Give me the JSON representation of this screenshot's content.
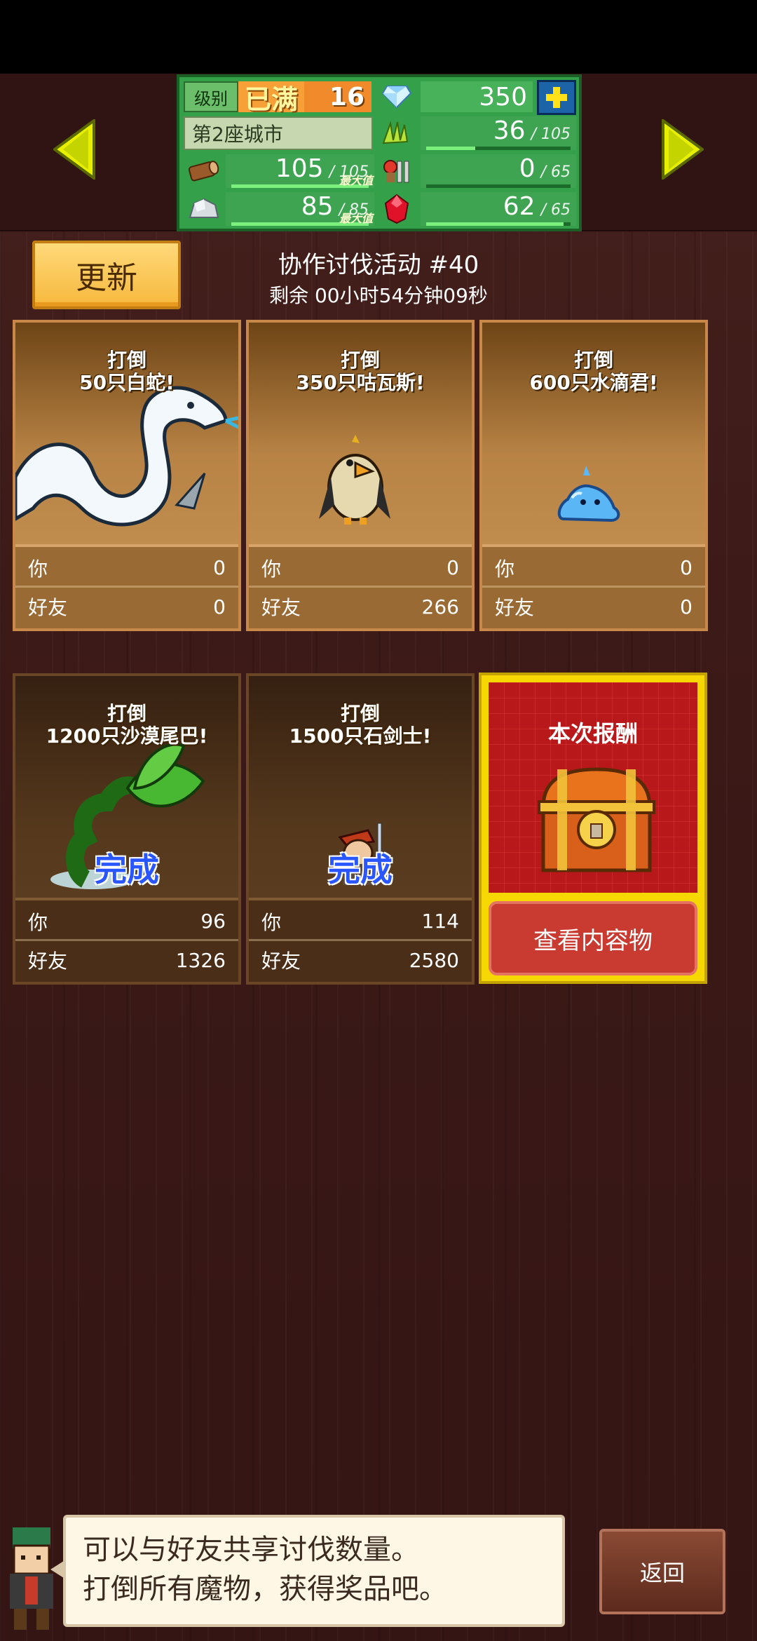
{
  "header": {
    "level_label": "级别",
    "level_max": "已满",
    "level_value": "16",
    "gems": "350",
    "city": "第2座城市",
    "max_tag": "最大值",
    "resources": [
      {
        "icon": "wood-icon",
        "value": "105",
        "max": "105",
        "fill": 1.0
      },
      {
        "icon": "stone-icon",
        "value": "85",
        "max": "85",
        "fill": 1.0
      },
      {
        "icon": "grass-icon",
        "value": "36",
        "max": "105",
        "fill": 0.34
      },
      {
        "icon": "food-icon",
        "value": "0",
        "max": "65",
        "fill": 0.0
      },
      {
        "icon": "ruby-icon",
        "value": "62",
        "max": "65",
        "fill": 0.95
      }
    ]
  },
  "event": {
    "update_label": "更新",
    "title": "协作讨伐活动 #40",
    "timer": "剩余 00小时54分钟09秒"
  },
  "cards": [
    {
      "goal_line1": "打倒",
      "goal_line2": "50只白蛇!",
      "you_label": "你",
      "you": "0",
      "friends_label": "好友",
      "friends": "0",
      "done": ""
    },
    {
      "goal_line1": "打倒",
      "goal_line2": "350只咕瓦斯!",
      "you_label": "你",
      "you": "0",
      "friends_label": "好友",
      "friends": "266",
      "done": ""
    },
    {
      "goal_line1": "打倒",
      "goal_line2": "600只水滴君!",
      "you_label": "你",
      "you": "0",
      "friends_label": "好友",
      "friends": "0",
      "done": ""
    },
    {
      "goal_line1": "打倒",
      "goal_line2": "1200只沙漠尾巴!",
      "you_label": "你",
      "you": "96",
      "friends_label": "好友",
      "friends": "1326",
      "done": "完成"
    },
    {
      "goal_line1": "打倒",
      "goal_line2": "1500只石剑士!",
      "you_label": "你",
      "you": "114",
      "friends_label": "好友",
      "friends": "2580",
      "done": "完成"
    }
  ],
  "reward": {
    "title": "本次报酬",
    "view_label": "查看内容物"
  },
  "dialog": {
    "line1": "可以与好友共享讨伐数量。",
    "line2": "打倒所有魔物，获得奖品吧。"
  },
  "back_label": "返回",
  "colors": {
    "stats_green": "#34a04a",
    "button_gold": "#f6b83c",
    "done_blue": "#2a56ff",
    "reward_red": "#b8181a",
    "reward_frame": "#f6d800"
  }
}
